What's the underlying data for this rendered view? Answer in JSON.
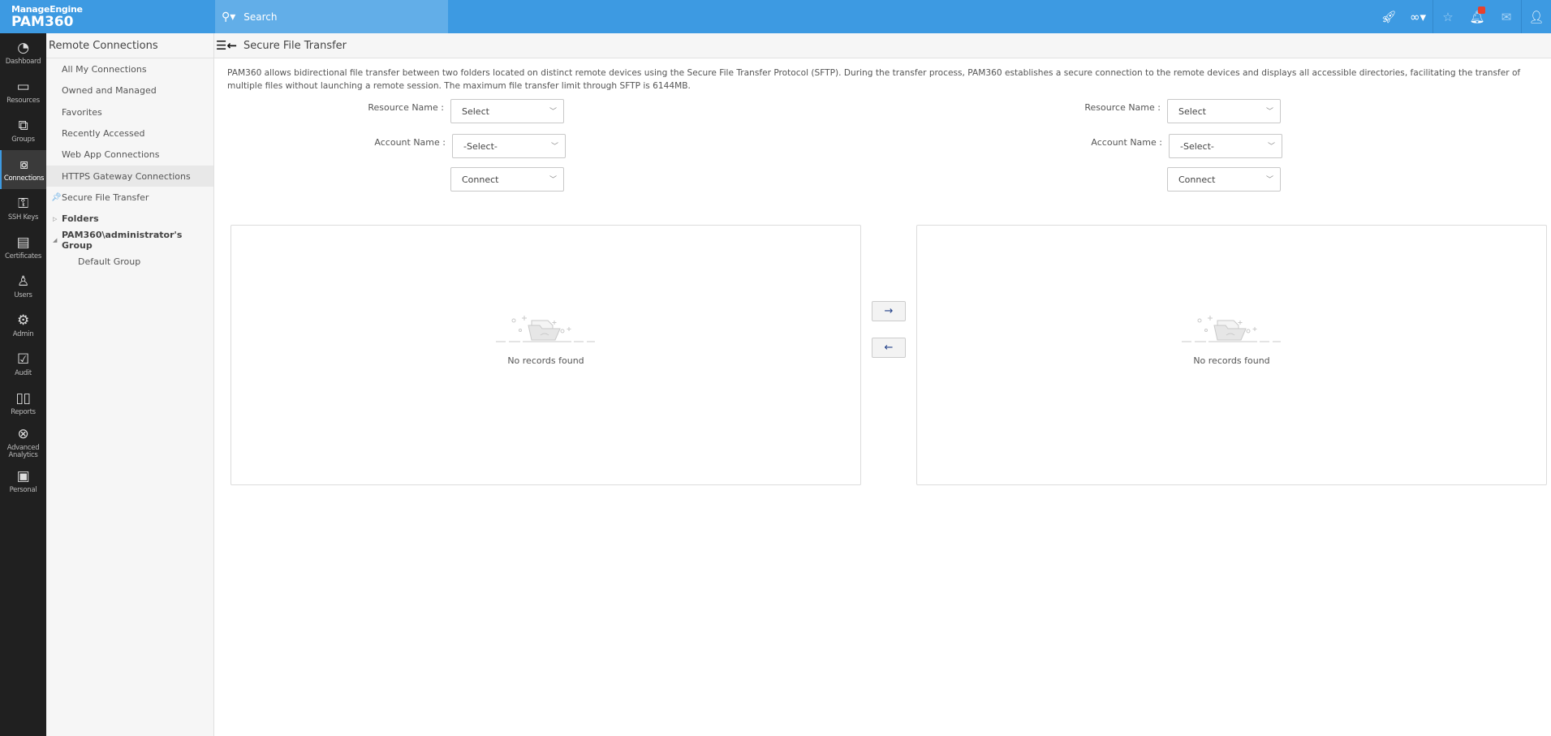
{
  "header": {
    "brand_top": "ManageEngine",
    "brand": "PAM360",
    "search_placeholder": "Search",
    "icons": [
      "rocket-icon",
      "link-icon",
      "user-star-icon",
      "bell-icon",
      "mail-icon",
      "user-menu-icon"
    ]
  },
  "nav": [
    {
      "label": "Dashboard"
    },
    {
      "label": "Resources"
    },
    {
      "label": "Groups"
    },
    {
      "label": "Connections",
      "active": true
    },
    {
      "label": "SSH Keys"
    },
    {
      "label": "Certificates"
    },
    {
      "label": "Users"
    },
    {
      "label": "Admin"
    },
    {
      "label": "Audit"
    },
    {
      "label": "Reports"
    },
    {
      "label": "Advanced Analytics"
    },
    {
      "label": "Personal"
    }
  ],
  "sidebar": {
    "title": "Remote Connections",
    "items": [
      {
        "label": "All My Connections"
      },
      {
        "label": "Owned and Managed"
      },
      {
        "label": "Favorites"
      },
      {
        "label": "Recently Accessed"
      },
      {
        "label": "Web App Connections"
      },
      {
        "label": "HTTPS Gateway Connections"
      },
      {
        "label": "Secure File Transfer"
      },
      {
        "label": "Folders"
      },
      {
        "label": "PAM360\\administrator's Group"
      },
      {
        "label": "Default Group"
      }
    ]
  },
  "page": {
    "title": "Secure File Transfer",
    "description": "PAM360 allows bidirectional file transfer between two folders located on distinct remote devices using the Secure File Transfer Protocol (SFTP). During the transfer process, PAM360 establishes a secure connection to the remote devices and displays all accessible directories, facilitating the transfer of multiple files without launching a remote session. The maximum file transfer limit through SFTP is 6144MB.",
    "left": {
      "resource_label": "Resource Name :",
      "resource_value": "Select",
      "account_label": "Account Name :",
      "account_value": "-Select-",
      "connect_value": "Connect",
      "empty": "No records found"
    },
    "right": {
      "resource_label": "Resource Name :",
      "resource_value": "Select",
      "account_label": "Account Name :",
      "account_value": "-Select-",
      "connect_value": "Connect",
      "empty": "No records found"
    },
    "transfer_right": "→",
    "transfer_left": "←"
  }
}
